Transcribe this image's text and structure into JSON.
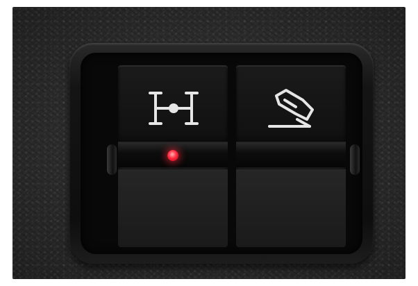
{
  "scene": {
    "controls": [
      {
        "id": "diff-lock",
        "icon": "differential-lock-icon",
        "indicator": "on",
        "indicator_color": "#ff2a3c"
      },
      {
        "id": "hill-descent",
        "icon": "hill-descent-vehicle-icon",
        "indicator": "off"
      }
    ]
  },
  "colors": {
    "leather": "#2b2b2b",
    "button": "#141414",
    "icon": "#e6e6e6",
    "led": "#ff2a3c"
  }
}
